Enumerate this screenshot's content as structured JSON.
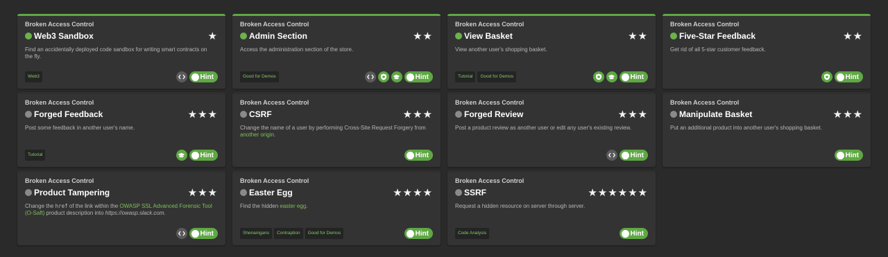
{
  "colors": {
    "accent": "#5fa844",
    "background": "#2a2a2a",
    "card": "#333333"
  },
  "hint_label": "Hint",
  "cards": [
    {
      "category": "Broken Access Control",
      "title": "Web3 Sandbox",
      "solved": true,
      "stars": "★",
      "desc_parts": [
        {
          "t": "Find an accidentally deployed code sandbox for writing smart contracts on the fly."
        }
      ],
      "tags": [
        "Web3"
      ],
      "icons": [
        "code-icon"
      ]
    },
    {
      "category": "Broken Access Control",
      "title": "Admin Section",
      "solved": true,
      "stars": "★★",
      "desc_parts": [
        {
          "t": "Access the administration section of the store."
        }
      ],
      "tags": [
        "Good for Demos"
      ],
      "icons": [
        "code-icon",
        "badge-icon",
        "mortarboard-icon"
      ]
    },
    {
      "category": "Broken Access Control",
      "title": "View Basket",
      "solved": true,
      "stars": "★★",
      "desc_parts": [
        {
          "t": "View another user's shopping basket."
        }
      ],
      "tags": [
        "Tutorial",
        "Good for Demos"
      ],
      "icons": [
        "badge-icon",
        "mortarboard-icon"
      ]
    },
    {
      "category": "Broken Access Control",
      "title": "Five-Star Feedback",
      "solved": true,
      "stars": "★★",
      "desc_parts": [
        {
          "t": "Get rid of all 5-star customer feedback."
        }
      ],
      "tags": [],
      "icons": [
        "badge-icon"
      ]
    },
    {
      "category": "Broken Access Control",
      "title": "Forged Feedback",
      "solved": false,
      "stars": "★★★",
      "desc_parts": [
        {
          "t": "Post some feedback in another user's name."
        }
      ],
      "tags": [
        "Tutorial"
      ],
      "icons": [
        "mortarboard-icon"
      ]
    },
    {
      "category": "Broken Access Control",
      "title": "CSRF",
      "solved": false,
      "stars": "★★★",
      "desc_parts": [
        {
          "t": "Change the name of a user by performing Cross-Site Request Forgery from "
        },
        {
          "t": "another origin",
          "c": "link"
        },
        {
          "t": "."
        }
      ],
      "tags": [],
      "icons": []
    },
    {
      "category": "Broken Access Control",
      "title": "Forged Review",
      "solved": false,
      "stars": "★★★",
      "desc_parts": [
        {
          "t": "Post a product review as another user or edit any user's existing review."
        }
      ],
      "tags": [],
      "icons": [
        "code-icon"
      ]
    },
    {
      "category": "Broken Access Control",
      "title": "Manipulate Basket",
      "solved": false,
      "stars": "★★★",
      "desc_parts": [
        {
          "t": "Put an additional product into another user's shopping basket."
        }
      ],
      "tags": [],
      "icons": []
    },
    {
      "category": "Broken Access Control",
      "title": "Product Tampering",
      "solved": false,
      "stars": "★★★",
      "desc_parts": [
        {
          "t": "Change the "
        },
        {
          "t": "href",
          "c": "code"
        },
        {
          "t": " of the link within the "
        },
        {
          "t": "OWASP SSL Advanced Forensic Tool (O-Saft)",
          "c": "link"
        },
        {
          "t": " product description into "
        },
        {
          "t": "https://owasp.slack.com",
          "c": "italic"
        },
        {
          "t": "."
        }
      ],
      "tags": [],
      "icons": [
        "code-icon"
      ]
    },
    {
      "category": "Broken Access Control",
      "title": "Easter Egg",
      "solved": false,
      "stars": "★★★★",
      "desc_parts": [
        {
          "t": "Find the hidden "
        },
        {
          "t": "easter egg",
          "c": "link"
        },
        {
          "t": "."
        }
      ],
      "tags": [
        "Shenanigans",
        "Contraption",
        "Good for Demos"
      ],
      "icons": []
    },
    {
      "category": "Broken Access Control",
      "title": "SSRF",
      "solved": false,
      "stars": "★★★★★★",
      "desc_parts": [
        {
          "t": "Request a hidden resource on server through server."
        }
      ],
      "tags": [
        "Code Analysis"
      ],
      "icons": []
    }
  ]
}
